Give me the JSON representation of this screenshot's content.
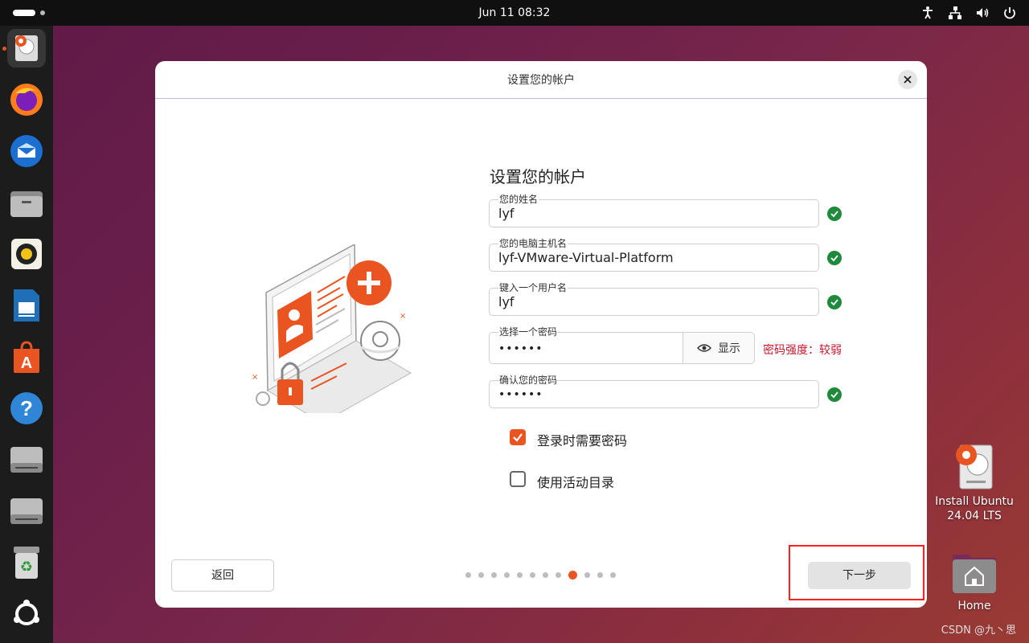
{
  "topbar": {
    "clock": "Jun 11  08:32"
  },
  "dock": {
    "items": [
      {
        "name": "installer"
      },
      {
        "name": "firefox"
      },
      {
        "name": "thunderbird"
      },
      {
        "name": "files"
      },
      {
        "name": "rhythmbox"
      },
      {
        "name": "writer"
      },
      {
        "name": "app-center"
      },
      {
        "name": "help"
      },
      {
        "name": "drive"
      },
      {
        "name": "drive"
      },
      {
        "name": "trash"
      },
      {
        "name": "show-apps"
      }
    ]
  },
  "dialog": {
    "header_title": "设置您的帐户",
    "form_title": "设置您的帐户",
    "fields": {
      "name": {
        "label": "您的姓名",
        "value": "lyf"
      },
      "hostname": {
        "label": "您的电脑主机名",
        "value": "lyf-VMware-Virtual-Platform"
      },
      "username": {
        "label": "键入一个用户名",
        "value": "lyf"
      },
      "password": {
        "label": "选择一个密码",
        "value": "••••••"
      },
      "confirm": {
        "label": "确认您的密码",
        "value": "••••••"
      }
    },
    "show_button": "显示",
    "password_strength": "密码强度：较弱",
    "checkboxes": {
      "require_password": {
        "label": "登录时需要密码",
        "checked": true
      },
      "active_directory": {
        "label": "使用活动目录",
        "checked": false
      }
    },
    "back_button": "返回",
    "next_button": "下一步",
    "pagination": {
      "total": 12,
      "current": 9
    }
  },
  "desktop": {
    "install_line1": "Install Ubuntu",
    "install_line2": "24.04 LTS",
    "home_label": "Home"
  },
  "watermark": "CSDN @九丶思",
  "colors": {
    "accent": "#e95420",
    "success": "#1f8a3c",
    "warning_text": "#c7162b",
    "annotation": "#ff1f1f"
  }
}
